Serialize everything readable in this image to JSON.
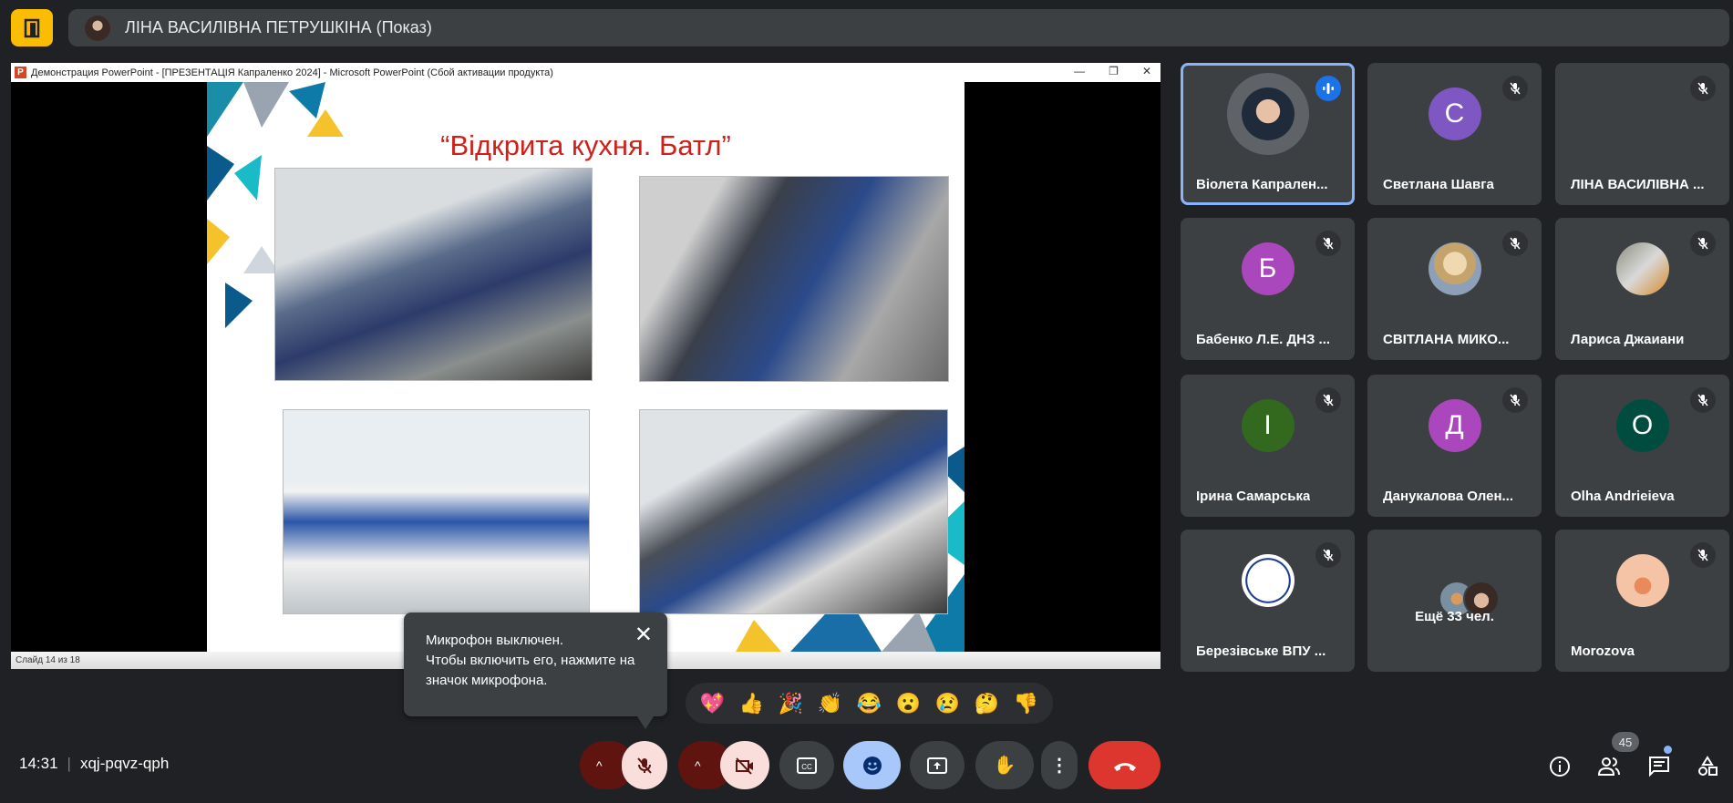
{
  "header": {
    "presenter": "ЛІНА ВАСИЛІВНА ПЕТРУШКІНА (Показ)"
  },
  "ppt": {
    "title": "Демонстрация PowerPoint - [ПРЕЗЕНТАЦІЯ Капраленко 2024] - Microsoft PowerPoint (Сбой активации продукта)",
    "slide_title": "“Відкрита кухня. Батл”",
    "status": "Слайд 14 из 18"
  },
  "participants": [
    {
      "name": "Віолета Капрален...",
      "speaking": true
    },
    {
      "name": "Светлана Шавга",
      "initial": "С",
      "color": "#7e57c2"
    },
    {
      "name": "ЛІНА ВАСИЛІВНА ..."
    },
    {
      "name": "Бабенко Л.Е. ДНЗ ...",
      "initial": "Б",
      "color": "#ab47bc"
    },
    {
      "name": "СВІТЛАНА МИКО..."
    },
    {
      "name": "Лариса Джаиани"
    },
    {
      "name": "Ірина Самарська",
      "initial": "І",
      "color": "#33691e"
    },
    {
      "name": "Данукалова Олен...",
      "initial": "Д",
      "color": "#ab47bc"
    },
    {
      "name": "Olha Andrieieva",
      "initial": "O",
      "color": "#004d40"
    },
    {
      "name": "Березівське ВПУ ..."
    },
    {
      "name": "Ещё 33 чел."
    },
    {
      "name": "Morozova"
    }
  ],
  "tooltip": {
    "line1": "Микрофон выключен.",
    "line2": "Чтобы включить его, нажмите на значок микрофона.",
    "close": "✕"
  },
  "emojis": [
    "💖",
    "👍",
    "🎉",
    "👏",
    "😂",
    "😮",
    "😢",
    "🤔",
    "👎"
  ],
  "bottom": {
    "time": "14:31",
    "meeting_code": "xqj-pqvz-qph",
    "participant_count": "45"
  },
  "colors": {
    "accent": "#8ab4f8",
    "end_call": "#dc362e",
    "muted": "#f9dedc",
    "muted_dark": "#601410"
  }
}
